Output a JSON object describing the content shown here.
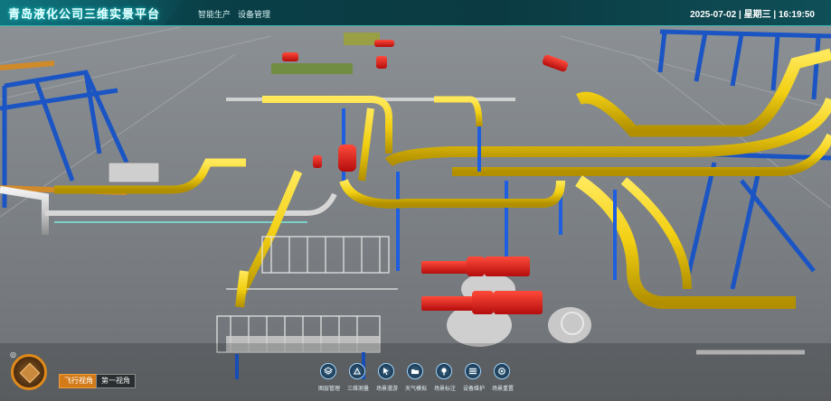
{
  "app": {
    "title": "青岛液化公司三维实景平台"
  },
  "nav": [
    {
      "label": "智能生产"
    },
    {
      "label": "设备管理"
    }
  ],
  "datetime": {
    "date": "2025-07-02",
    "separator1": " | ",
    "weekday": "星期三",
    "separator2": " | ",
    "time": "16:19:50"
  },
  "view_buttons": {
    "fly": "飞行视角",
    "first": "第一视角"
  },
  "toolbar": [
    {
      "label": "图层管理",
      "icon": "layers-icon"
    },
    {
      "label": "三维测量",
      "icon": "measure-icon"
    },
    {
      "label": "场景漫游",
      "icon": "cursor-icon"
    },
    {
      "label": "天气模拟",
      "icon": "folder-icon"
    },
    {
      "label": "场景标注",
      "icon": "pin-icon"
    },
    {
      "label": "设备维护",
      "icon": "stack-icon"
    },
    {
      "label": "场景重置",
      "icon": "reset-icon"
    }
  ],
  "colors": {
    "accent": "#3fb7b5",
    "pipe_yellow": "#f5d21a",
    "valve_red": "#d81b1b",
    "frame_blue": "#1b55c4"
  }
}
